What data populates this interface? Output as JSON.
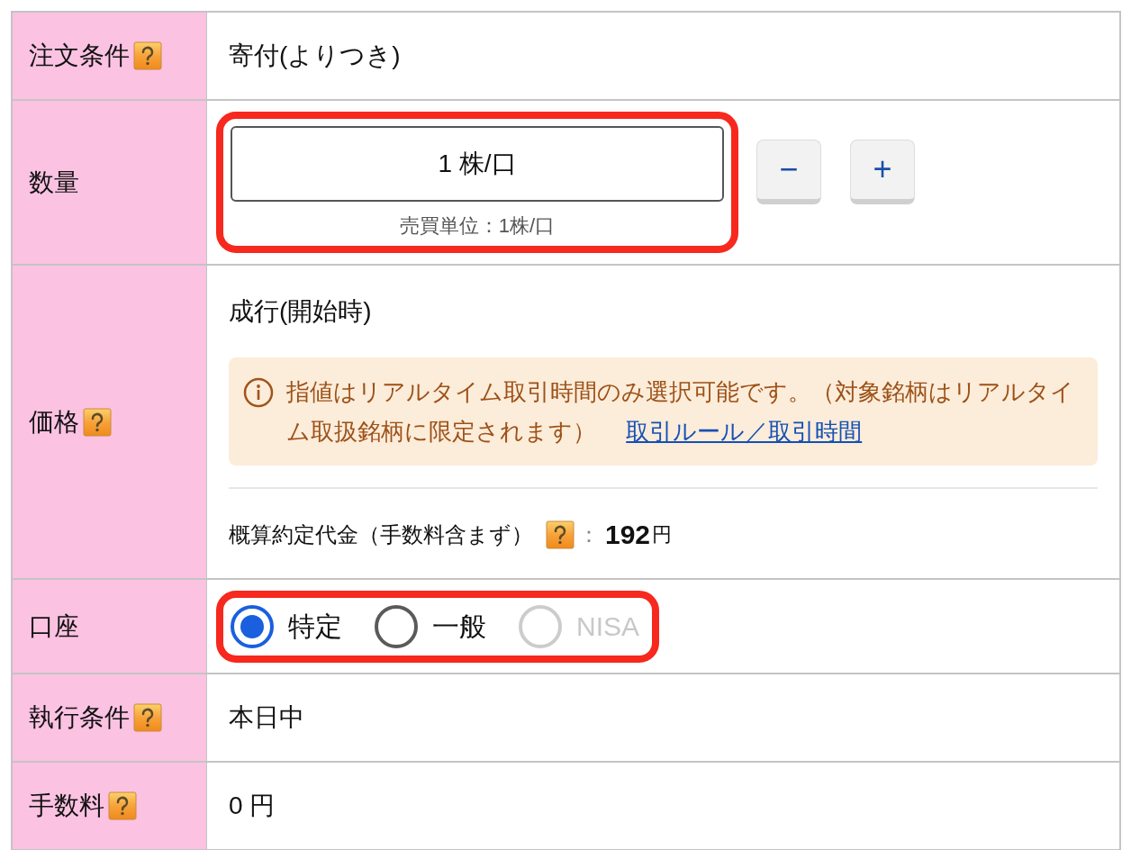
{
  "rows": [
    {
      "kind": "text",
      "label": "注文条件",
      "help": true,
      "value": "寄付(よりつき)"
    },
    {
      "kind": "quantity",
      "label": "数量",
      "help": false,
      "value": "1 株/口",
      "unit_note": "売買単位：1株/口",
      "minus": "−",
      "plus": "+"
    },
    {
      "kind": "price",
      "label": "価格",
      "help": true,
      "value": "成行(開始時)",
      "notice": "指値はリアルタイム取引時間のみ選択可能です。（対象銘柄はリアルタイム取扱銘柄に限定されます）",
      "notice_link": "取引ルール／取引時間",
      "estimate_label": "概算約定代金（手数料含まず）",
      "estimate_sep": "：",
      "estimate_value": "192",
      "estimate_unit": "円"
    },
    {
      "kind": "account",
      "label": "口座",
      "help": false,
      "options": [
        {
          "label": "特定",
          "selected": true,
          "disabled": false
        },
        {
          "label": "一般",
          "selected": false,
          "disabled": false
        },
        {
          "label": "NISA",
          "selected": false,
          "disabled": true
        }
      ]
    },
    {
      "kind": "text",
      "label": "執行条件",
      "help": true,
      "value": "本日中"
    },
    {
      "kind": "text",
      "label": "手数料",
      "help": true,
      "value": "0 円"
    }
  ]
}
